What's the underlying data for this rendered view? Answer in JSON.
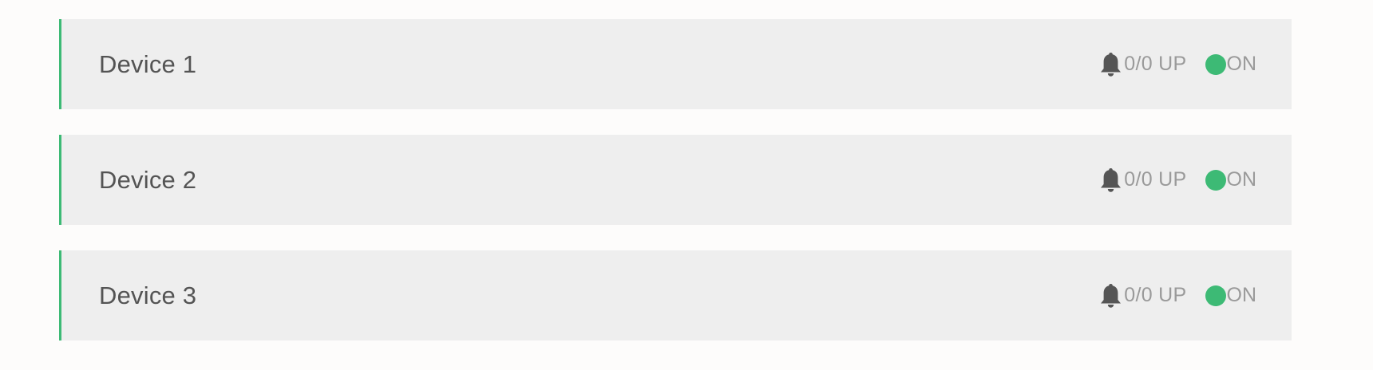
{
  "accent_color": "#3dba75",
  "devices": [
    {
      "name": "Device 1",
      "alerts": "0/0 UP",
      "status": "ON",
      "alert_icon": "bell-icon"
    },
    {
      "name": "Device 2",
      "alerts": "0/0 UP",
      "status": "ON",
      "alert_icon": "bell-icon"
    },
    {
      "name": "Device 3",
      "alerts": "0/0 UP",
      "status": "ON",
      "alert_icon": "bell-icon"
    }
  ]
}
